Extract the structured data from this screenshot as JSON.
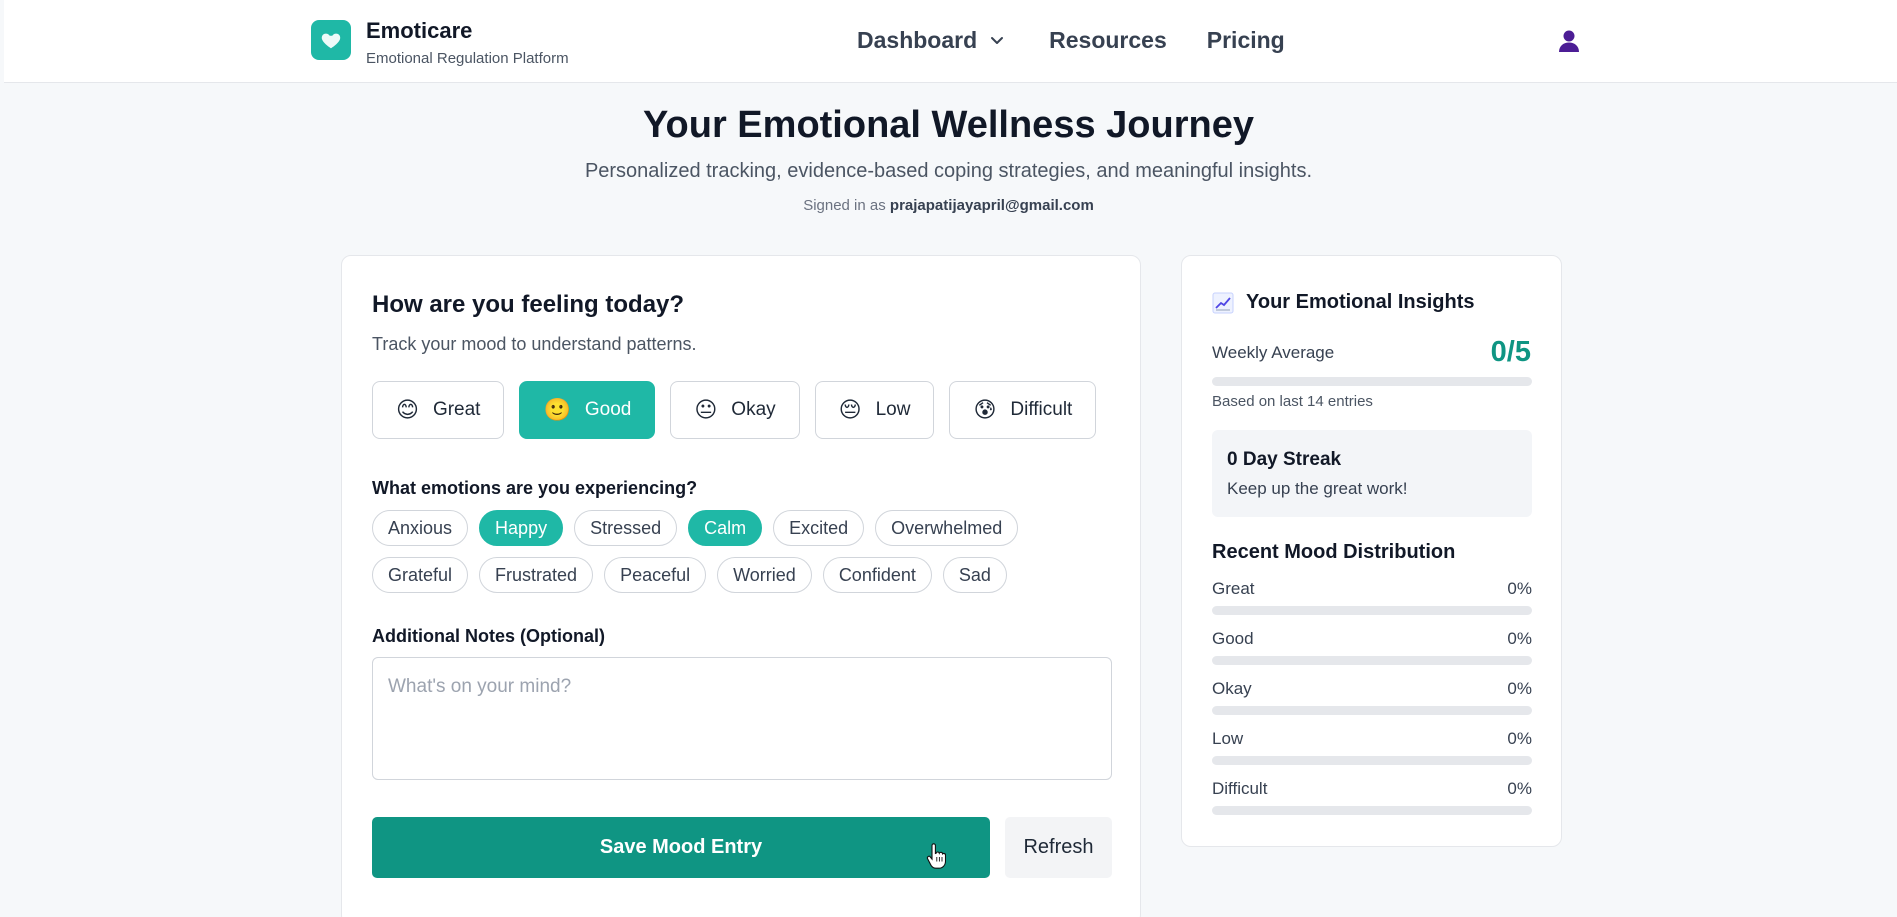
{
  "header": {
    "brand_name": "Emoticare",
    "brand_subtitle": "Emotional Regulation Platform",
    "nav": [
      {
        "label": "Dashboard"
      },
      {
        "label": "Resources"
      },
      {
        "label": "Pricing"
      }
    ],
    "icons": {
      "logo": "heart-icon",
      "dropdown": "chevron-down-icon",
      "user": "user-icon"
    }
  },
  "hero": {
    "title": "Your Emotional Wellness Journey",
    "subtitle": "Personalized tracking, evidence-based coping strategies, and meaningful insights.",
    "signed_in_prefix": "Signed in as",
    "email": "prajapatijayapril@gmail.com"
  },
  "mood_card": {
    "title": "How are you feeling today?",
    "subtitle": "Track your mood to understand patterns.",
    "moods": [
      {
        "label": "Great",
        "emoji": "😊",
        "selected": false
      },
      {
        "label": "Good",
        "emoji": "🙂",
        "selected": true
      },
      {
        "label": "Okay",
        "emoji": "😐",
        "selected": false
      },
      {
        "label": "Low",
        "emoji": "😔",
        "selected": false
      },
      {
        "label": "Difficult",
        "emoji": "😰",
        "selected": false
      }
    ],
    "emotions_title": "What emotions are you experiencing?",
    "emotions": [
      {
        "label": "Anxious",
        "selected": false
      },
      {
        "label": "Happy",
        "selected": true
      },
      {
        "label": "Stressed",
        "selected": false
      },
      {
        "label": "Calm",
        "selected": true
      },
      {
        "label": "Excited",
        "selected": false
      },
      {
        "label": "Overwhelmed",
        "selected": false
      },
      {
        "label": "Grateful",
        "selected": false
      },
      {
        "label": "Frustrated",
        "selected": false
      },
      {
        "label": "Peaceful",
        "selected": false
      },
      {
        "label": "Worried",
        "selected": false
      },
      {
        "label": "Confident",
        "selected": false
      },
      {
        "label": "Sad",
        "selected": false
      }
    ],
    "notes_title": "Additional Notes (Optional)",
    "notes_placeholder": "What's on your mind?",
    "notes_value": "",
    "save_label": "Save Mood Entry",
    "refresh_label": "Refresh"
  },
  "insights": {
    "title": "Your Emotional Insights",
    "title_icon": "chart-icon",
    "weekly_label": "Weekly Average",
    "weekly_value": "0/5",
    "weekly_fraction": 0,
    "based_on": "Based on last 14 entries",
    "streak_title": "0 Day Streak",
    "streak_sub": "Keep up the great work!",
    "distribution_title": "Recent Mood Distribution",
    "distribution": [
      {
        "label": "Great",
        "pct": "0%",
        "value": 0
      },
      {
        "label": "Good",
        "pct": "0%",
        "value": 0
      },
      {
        "label": "Okay",
        "pct": "0%",
        "value": 0
      },
      {
        "label": "Low",
        "pct": "0%",
        "value": 0
      },
      {
        "label": "Difficult",
        "pct": "0%",
        "value": 0
      }
    ]
  },
  "colors": {
    "accent": "#1fb8a6",
    "accent_dark": "#0f9583",
    "background": "#f6f8fa"
  }
}
